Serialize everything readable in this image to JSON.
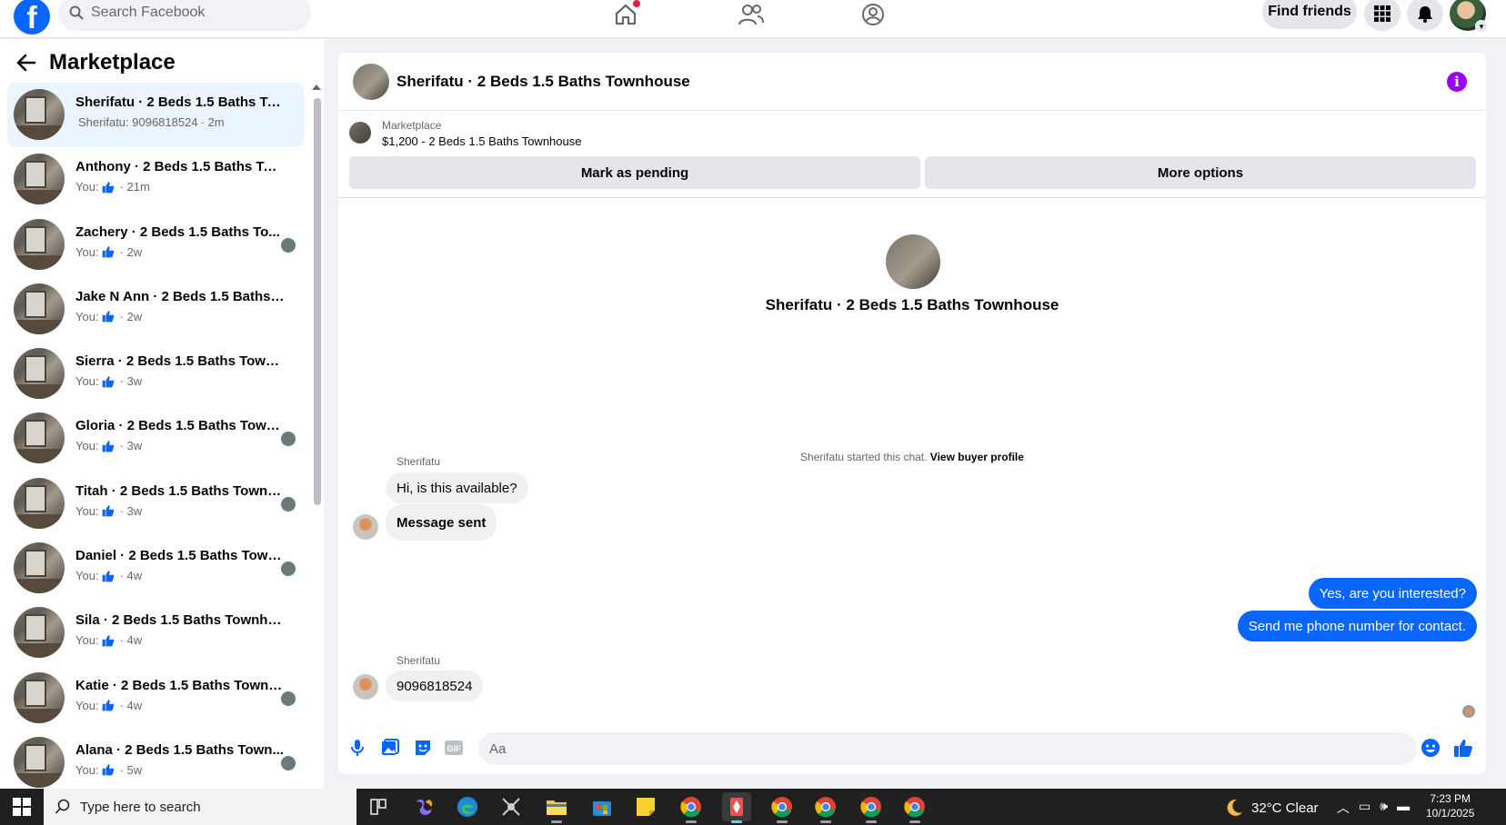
{
  "topbar": {
    "logo_letter": "f",
    "search_placeholder": "Search Facebook",
    "find_friends": "Find friends"
  },
  "left": {
    "title": "Marketplace",
    "conversations": [
      {
        "name": "Sherifatu · 2 Beds 1.5 Baths Tow...",
        "prefix": "",
        "text": "Sherifatu: 9096818524",
        "time": "· 2m",
        "active": true,
        "seen": false
      },
      {
        "name": "Anthony · 2 Beds 1.5 Baths Town...",
        "prefix": "You:",
        "text": "",
        "time": "· 21m",
        "active": false,
        "seen": false
      },
      {
        "name": "Zachery · 2 Beds 1.5 Baths To...",
        "prefix": "You:",
        "text": "",
        "time": "· 2w",
        "active": false,
        "seen": true
      },
      {
        "name": "Jake N Ann · 2 Beds 1.5 Baths To...",
        "prefix": "You:",
        "text": "",
        "time": "· 2w",
        "active": false,
        "seen": false
      },
      {
        "name": "Sierra · 2 Beds 1.5 Baths Townho...",
        "prefix": "You:",
        "text": "",
        "time": "· 3w",
        "active": false,
        "seen": false
      },
      {
        "name": "Gloria · 2 Beds 1.5 Baths Town...",
        "prefix": "You:",
        "text": "",
        "time": "· 3w",
        "active": false,
        "seen": true
      },
      {
        "name": "Titah · 2 Beds 1.5 Baths Townh...",
        "prefix": "You:",
        "text": "",
        "time": "· 3w",
        "active": false,
        "seen": true
      },
      {
        "name": "Daniel · 2 Beds 1.5 Baths Town...",
        "prefix": "You:",
        "text": "",
        "time": "· 4w",
        "active": false,
        "seen": true
      },
      {
        "name": "Sila · 2 Beds 1.5 Baths Townhouse",
        "prefix": "You:",
        "text": "",
        "time": "· 4w",
        "active": false,
        "seen": false
      },
      {
        "name": "Katie · 2 Beds 1.5 Baths Townh...",
        "prefix": "You:",
        "text": "",
        "time": "· 4w",
        "active": false,
        "seen": true
      },
      {
        "name": "Alana · 2 Beds 1.5 Baths Town...",
        "prefix": "You:",
        "text": "",
        "time": "· 5w",
        "active": false,
        "seen": true
      }
    ]
  },
  "chat": {
    "title": "Sherifatu · 2 Beds 1.5 Baths Townhouse",
    "info_glyph": "i",
    "listing_category": "Marketplace",
    "listing_summary": "$1,200 - 2 Beds 1.5 Baths Townhouse",
    "mark_pending": "Mark as pending",
    "more_options": "More options",
    "intro_name": "Sherifatu · 2 Beds 1.5 Baths Townhouse",
    "started_text": "Sherifatu started this chat.",
    "view_profile": "View buyer profile",
    "sender_name": "Sherifatu",
    "msg_1": "Hi, is this available?",
    "msg_2": "Message sent",
    "msg_3": "Yes, are you interested?",
    "msg_4": "Send me phone number for contact.",
    "sender_name_2": "Sherifatu",
    "msg_5": "9096818524",
    "composer_placeholder": "Aa"
  },
  "taskbar": {
    "search_placeholder": "Type here to search",
    "weather": "32°C  Clear",
    "time": "7:23 PM",
    "date": "10/1/2025"
  },
  "colors": {
    "accent": "#0866ff",
    "info": "#9a00ff",
    "active_row": "#ebf5ff"
  }
}
